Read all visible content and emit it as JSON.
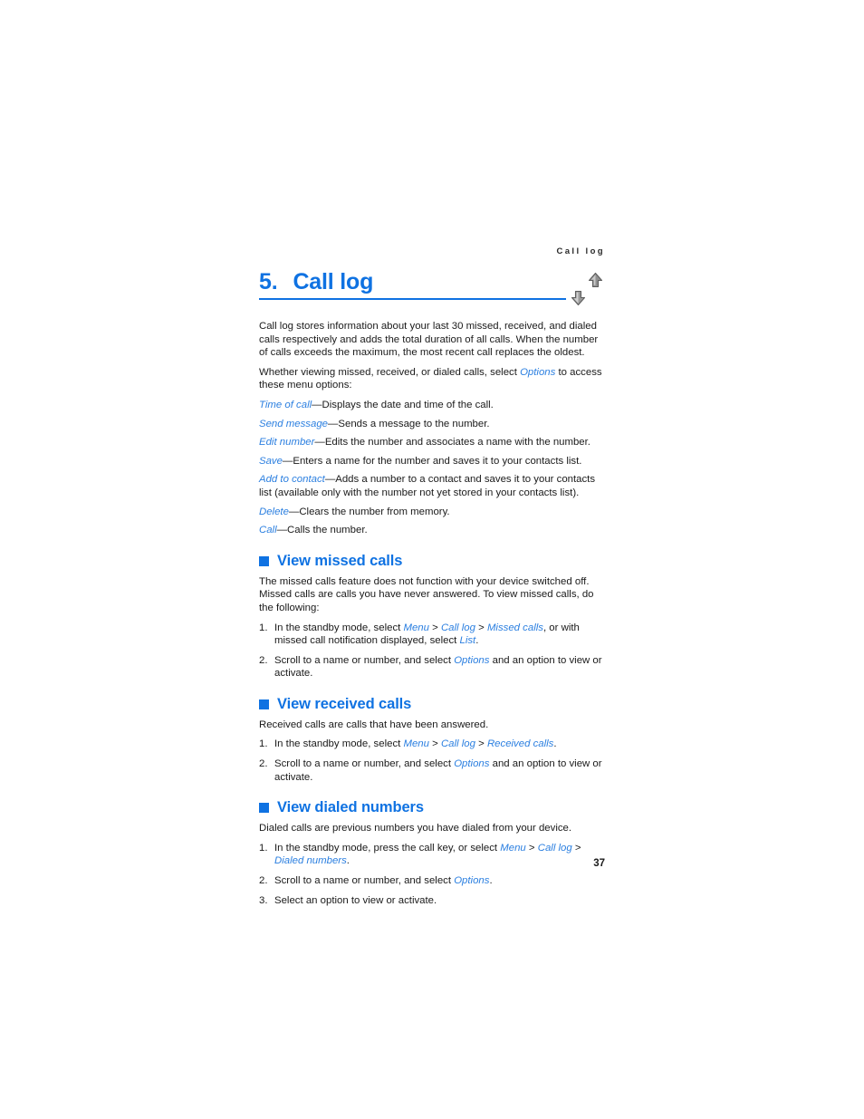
{
  "header": {
    "running_head": "Call log"
  },
  "chapter": {
    "number": "5.",
    "title": "Call log",
    "icon": "up-down-arrows-icon"
  },
  "intro": {
    "para1": "Call log stores information about your last 30 missed, received, and dialed calls respectively and adds the total duration of all calls. When the number of calls exceeds the maximum, the most recent call replaces the oldest.",
    "para2_a": "Whether viewing missed, received, or dialed calls, select ",
    "para2_ui": "Options",
    "para2_b": " to access these menu options:"
  },
  "options": [
    {
      "term": "Time of call",
      "desc": "—Displays the date and time of the call."
    },
    {
      "term": "Send message",
      "desc": "—Sends a message to the number."
    },
    {
      "term": "Edit number",
      "desc": "—Edits the number and associates a name with the number."
    },
    {
      "term": "Save",
      "desc": "—Enters a name for the number and saves it to your contacts list."
    },
    {
      "term": "Add to contact",
      "desc": "—Adds a number to a contact and saves it to your contacts list (available only with the number not yet stored in your contacts list)."
    },
    {
      "term": "Delete",
      "desc": "—Clears the number from memory."
    },
    {
      "term": "Call",
      "desc": "—Calls the number."
    }
  ],
  "sections": {
    "missed": {
      "heading": "View missed calls",
      "intro": "The missed calls feature does not function with your device switched off. Missed calls are calls you have never answered. To view missed calls, do the following:",
      "steps": [
        {
          "num": "1.",
          "parts": [
            {
              "t": "text",
              "v": "In the standby mode, select "
            },
            {
              "t": "ui",
              "v": "Menu"
            },
            {
              "t": "text",
              "v": " > "
            },
            {
              "t": "ui",
              "v": "Call log"
            },
            {
              "t": "text",
              "v": " > "
            },
            {
              "t": "ui",
              "v": "Missed calls"
            },
            {
              "t": "text",
              "v": ", or with missed call notification displayed, select "
            },
            {
              "t": "ui",
              "v": "List"
            },
            {
              "t": "text",
              "v": "."
            }
          ]
        },
        {
          "num": "2.",
          "parts": [
            {
              "t": "text",
              "v": "Scroll to a name or number, and select "
            },
            {
              "t": "ui",
              "v": "Options"
            },
            {
              "t": "text",
              "v": " and an option to view or activate."
            }
          ]
        }
      ]
    },
    "received": {
      "heading": "View received calls",
      "intro": "Received calls are calls that have been answered.",
      "steps": [
        {
          "num": "1.",
          "parts": [
            {
              "t": "text",
              "v": "In the standby mode, select "
            },
            {
              "t": "ui",
              "v": "Menu"
            },
            {
              "t": "text",
              "v": " > "
            },
            {
              "t": "ui",
              "v": "Call log"
            },
            {
              "t": "text",
              "v": " > "
            },
            {
              "t": "ui",
              "v": "Received calls"
            },
            {
              "t": "text",
              "v": "."
            }
          ]
        },
        {
          "num": "2.",
          "parts": [
            {
              "t": "text",
              "v": "Scroll to a name or number, and select "
            },
            {
              "t": "ui",
              "v": "Options"
            },
            {
              "t": "text",
              "v": " and an option to view or activate."
            }
          ]
        }
      ]
    },
    "dialed": {
      "heading": "View dialed numbers",
      "intro": "Dialed calls are previous numbers you have dialed from your device.",
      "steps": [
        {
          "num": "1.",
          "parts": [
            {
              "t": "text",
              "v": "In the standby mode, press the call key, or select "
            },
            {
              "t": "ui",
              "v": "Menu"
            },
            {
              "t": "text",
              "v": " > "
            },
            {
              "t": "ui",
              "v": "Call log"
            },
            {
              "t": "text",
              "v": " > "
            },
            {
              "t": "ui",
              "v": "Dialed numbers"
            },
            {
              "t": "text",
              "v": "."
            }
          ]
        },
        {
          "num": "2.",
          "parts": [
            {
              "t": "text",
              "v": "Scroll to a name or number, and select "
            },
            {
              "t": "ui",
              "v": "Options"
            },
            {
              "t": "text",
              "v": "."
            }
          ]
        },
        {
          "num": "3.",
          "parts": [
            {
              "t": "text",
              "v": "Select an option to view or activate."
            }
          ]
        }
      ]
    }
  },
  "footer": {
    "page_number": "37"
  },
  "colors": {
    "accent_blue": "#0f72e2",
    "ui_term_blue": "#2b7fe0",
    "body_text": "#1a1a1a"
  }
}
